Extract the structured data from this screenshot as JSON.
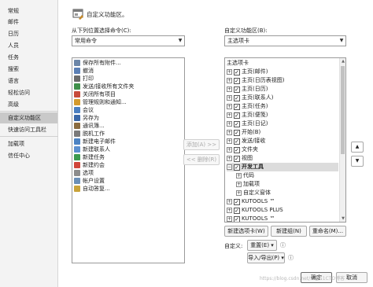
{
  "nav": {
    "items": [
      "常规",
      "邮件",
      "日历",
      "人员",
      "任务",
      "搜索",
      "语言",
      "轻松访问",
      "高级",
      "自定义功能区",
      "快速访问工具栏",
      "加载项",
      "信任中心"
    ]
  },
  "header": {
    "title": "自定义功能区。"
  },
  "left": {
    "label": "从下列位置选择命令(C):",
    "dropdown_value": "常用命令",
    "commands": [
      "保存所有附件...",
      "撤消",
      "打印",
      "发送/接收所有文件夹",
      "关闭所有项目",
      "管理规则和通知...",
      "会议",
      "另存为",
      "通讯簿...",
      "脱机工作",
      "新建电子邮件",
      "新建联系人",
      "新建任务",
      "新建约会",
      "选项",
      "帐户设置",
      "自动答复..."
    ]
  },
  "middle": {
    "add_label": "添加(A) >>",
    "remove_label": "<< 删除(R)"
  },
  "right": {
    "label": "自定义功能区(B):",
    "dropdown_value": "主选项卡",
    "tree_header": "主选项卡",
    "tree": [
      {
        "label": "主页(邮件)",
        "checked": true,
        "expanded": false,
        "level": 0
      },
      {
        "label": "主页(日历表视图)",
        "checked": true,
        "expanded": false,
        "level": 0
      },
      {
        "label": "主页(日历)",
        "checked": true,
        "expanded": false,
        "level": 0
      },
      {
        "label": "主页(联系人)",
        "checked": true,
        "expanded": false,
        "level": 0
      },
      {
        "label": "主页(任务)",
        "checked": true,
        "expanded": false,
        "level": 0
      },
      {
        "label": "主页(便笺)",
        "checked": true,
        "expanded": false,
        "level": 0
      },
      {
        "label": "主页(日记)",
        "checked": true,
        "expanded": false,
        "level": 0
      },
      {
        "label": "开始(B)",
        "checked": true,
        "expanded": false,
        "level": 0
      },
      {
        "label": "发送/接收",
        "checked": true,
        "expanded": false,
        "level": 0
      },
      {
        "label": "文件夹",
        "checked": true,
        "expanded": false,
        "level": 0
      },
      {
        "label": "视图",
        "checked": true,
        "expanded": false,
        "level": 0
      },
      {
        "label": "开发工具",
        "checked": true,
        "expanded": true,
        "level": 0,
        "selected": true
      },
      {
        "label": "代码",
        "checked": null,
        "expanded": false,
        "level": 1
      },
      {
        "label": "加载项",
        "checked": null,
        "expanded": false,
        "level": 1
      },
      {
        "label": "自定义窗体",
        "checked": null,
        "expanded": false,
        "level": 1
      },
      {
        "label": "KUTOOLS ™",
        "checked": true,
        "expanded": false,
        "level": 0
      },
      {
        "label": "KUTOOLS PLUS",
        "checked": true,
        "expanded": false,
        "level": 0
      },
      {
        "label": "KUTOOLS ™",
        "checked": true,
        "expanded": false,
        "level": 0
      }
    ],
    "new_tab_label": "新建选项卡(W)",
    "new_group_label": "新建组(N)",
    "rename_label": "重命名(M)...",
    "customize_label": "自定义:",
    "reset_label": "重置(E) ▾",
    "import_export_label": "导入/导出(P) ▾"
  },
  "footer": {
    "ok_label": "确定",
    "cancel_label": "取消"
  },
  "watermark": "https://blog.csdn.net/...@51CTO博客"
}
